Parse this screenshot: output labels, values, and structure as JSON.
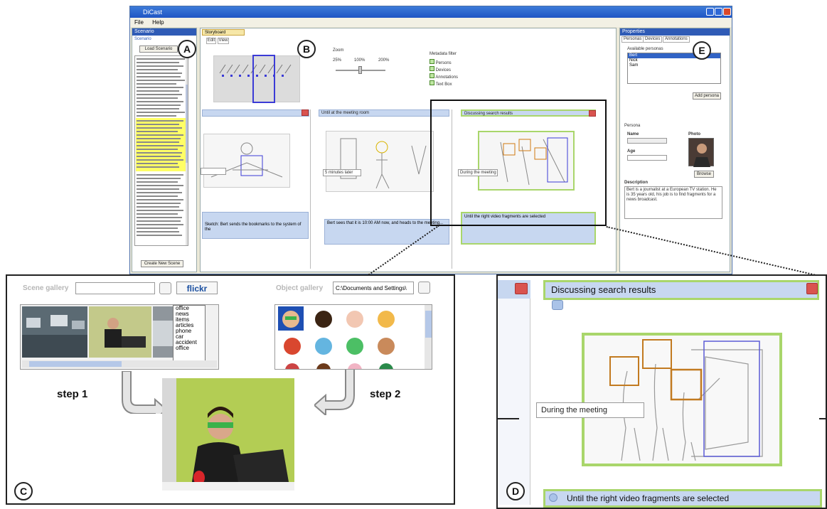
{
  "window": {
    "title": "DiCast",
    "menu": [
      "File",
      "Help"
    ]
  },
  "left_panel": {
    "header": "Scenario",
    "subheader": "Scenario",
    "load_button": "Load Scenario",
    "create_button": "Create New Scene"
  },
  "center": {
    "tab": "Storyboard",
    "subtabs": [
      "Edit",
      "View"
    ],
    "zoom_label": "Zoom",
    "zoom_ticks": [
      "25%",
      "100%",
      "200%"
    ],
    "metadata_title": "Metadata filter",
    "metadata_options": [
      "Persons",
      "Devices",
      "Annotations",
      "Text Box"
    ],
    "scenes": [
      {
        "title": "",
        "caption": "",
        "note": "Sketch: Bert sends the bookmarks to the system of the"
      },
      {
        "title": "Until at the meeting room",
        "caption": "5 minutes later",
        "note": "Bert sees that it is 10:00 AM now, and heads to the meeting..."
      },
      {
        "title": "Discussing search results",
        "caption": "During the meeting",
        "note": "Until the right video fragments are selected"
      }
    ]
  },
  "right_panel": {
    "header": "Properties",
    "tabs": [
      "Personas",
      "Devices",
      "Annotations"
    ],
    "available_label": "Available personas",
    "personas": [
      "Bert",
      "Nick",
      "Sam"
    ],
    "add_button": "Add persona",
    "persona_label": "Persona",
    "name_label": "Name",
    "age_label": "Age",
    "photo_label": "Photo",
    "browse_button": "Browse",
    "description_label": "Description",
    "description_text": "Bert is a journalist at a European TV station. He is 35 years old, his job is to find fragments for a news broadcast."
  },
  "labels": {
    "a": "A",
    "b": "B",
    "c": "C",
    "d": "D",
    "e": "E"
  },
  "detail_c": {
    "scene_gallery": "Scene gallery",
    "flickr": "flickr",
    "object_gallery": "Object gallery",
    "path": "C:\\Documents and Settings\\",
    "tags": [
      "office",
      "news",
      "items",
      "articles",
      "phone",
      "car",
      "accident",
      "office"
    ],
    "step1": "step 1",
    "step2": "step 2"
  },
  "detail_d": {
    "title": "Discussing search results",
    "caption": "During the meeting",
    "bottom": "Until the right video fragments are selected"
  },
  "colors": {
    "title_blue": "#1f55c4",
    "highlight_yellow": "#ffff66",
    "scene_green": "#a9d66b",
    "person_orange": "#d07a12",
    "device_blue": "#3b3bd6"
  }
}
